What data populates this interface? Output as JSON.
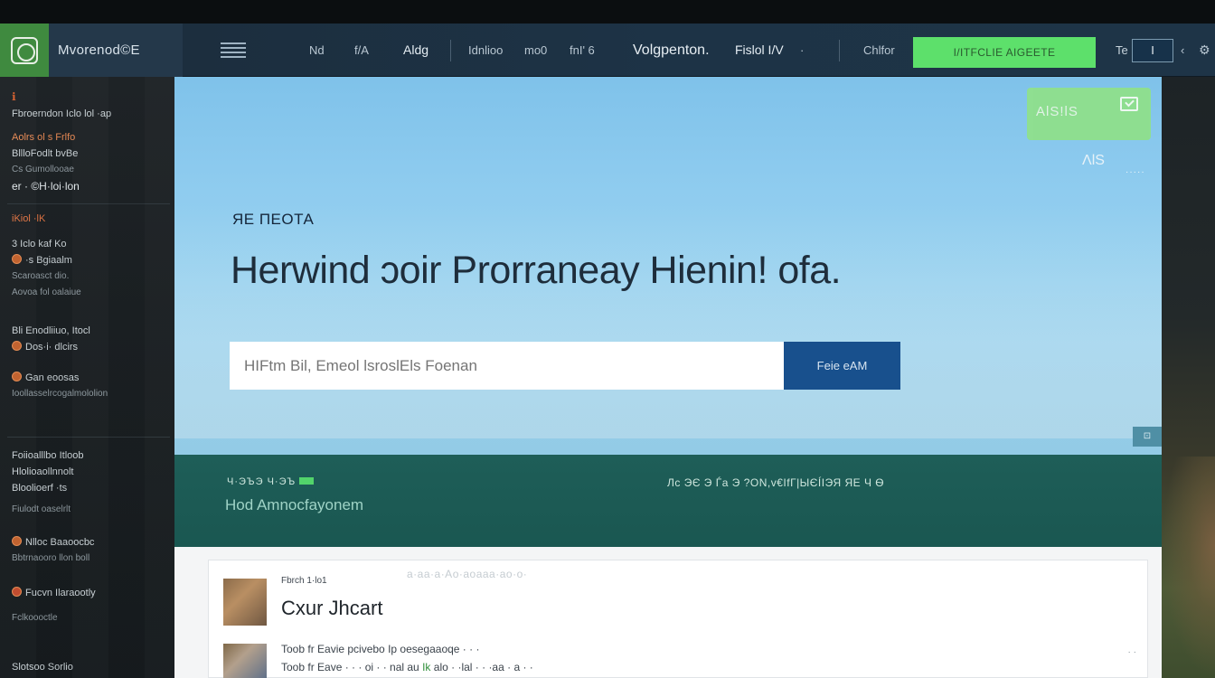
{
  "navbar": {
    "brand": "Mvorenod©E",
    "items": [
      "Nd",
      "f/A",
      "Aldg",
      "Idnlioo",
      "mo0",
      "fnI' 6"
    ],
    "primary": "Volgpenton.",
    "secondary": "Fislol I/V",
    "small_sep": "·",
    "right_link": "Chlfor",
    "cta_label": "I/ITFCLIE AIGEETE",
    "lang_prefix": "Te",
    "lang_box": "I",
    "chevron": "‹",
    "gear": "⚙"
  },
  "sidebar": {
    "groups": [
      {
        "title": "ℹ",
        "rows": [
          "Fbroerndon Iclo lol  ·ap"
        ]
      },
      {
        "title": "",
        "rows": [
          "Aolrs ol s Frlfo",
          "BllloFodlt bvBe",
          "Cs Gumollooae"
        ]
      },
      {
        "title": "",
        "rows": [
          "er ·  ©H·loi·lon"
        ]
      },
      {
        "title": "",
        "rows": [
          "3 Iclo kaf Ko",
          "·s Bgiaalm",
          "Scaroasct dio.",
          "Aovoa fol  oalaiue"
        ]
      },
      {
        "title": "",
        "rows": [
          "Bli Enodliiuo, Itocl",
          "Dos·i· dlcirs",
          "Gan eoosas",
          "Ioollasselrcogalmololion"
        ]
      },
      {
        "title": "",
        "rows": [
          "Foiioalllbo Itloob",
          "Hlolioaollnnolt",
          "Bloolioerf  ·ts",
          "Fiulodt oaselrlt"
        ]
      },
      {
        "title": "",
        "rows": [
          "Nlloc Baaoocbc",
          "Bbtrnaooro llon boll"
        ]
      },
      {
        "title": "",
        "rows": [
          "Fucvn  Ilaraootly",
          "Fclkoooctle"
        ]
      },
      {
        "title": "",
        "rows": [
          "Slotsoo Sorlio"
        ]
      }
    ],
    "accent_row": "iKiol ·lK"
  },
  "hero": {
    "eyebrow": "ЯЕ ПЕОТА",
    "title": "Herwind ɔoir Prorraneay Hienin! ofa.",
    "search_placeholder": "HIFtm Bil, Emeol lsroslEls Foenan",
    "search_button": "Feie eAM",
    "badge_label": "ΑlS!lS",
    "side_text": "ΛlS",
    "side_dots": "·····",
    "scroll_btn": "⊡"
  },
  "band": {
    "kicker": "Ч·ЭЪЭ  Ч·ЭЪ",
    "title": "Hod Amnocfayonem",
    "right": "Лс  ЭЄ  Э  Ѓа  Э  ?ОN,v€IfГ|ЫЄÍІЭЯ  ЯЕ Ч  Ѳ"
  },
  "content": {
    "faded": "a·aa·a·Ao·aoaaa·ao·o·",
    "card_kicker": "Fbrch 1·lo1",
    "card_title": "Cxur Jhcart",
    "line1": "Toob fr  Eavie pcivebo Ip oesegaaoqe   ·  ·  ·",
    "line2_start": "Toob fr  Eave  ·  ·  · oi ·  ·  nal  au",
    "line2_hl": "Ik",
    "line2_end": "alo  ·  ·lal ·  ·  ·aa ·  a ·  ·",
    "corner": "·  ·"
  }
}
